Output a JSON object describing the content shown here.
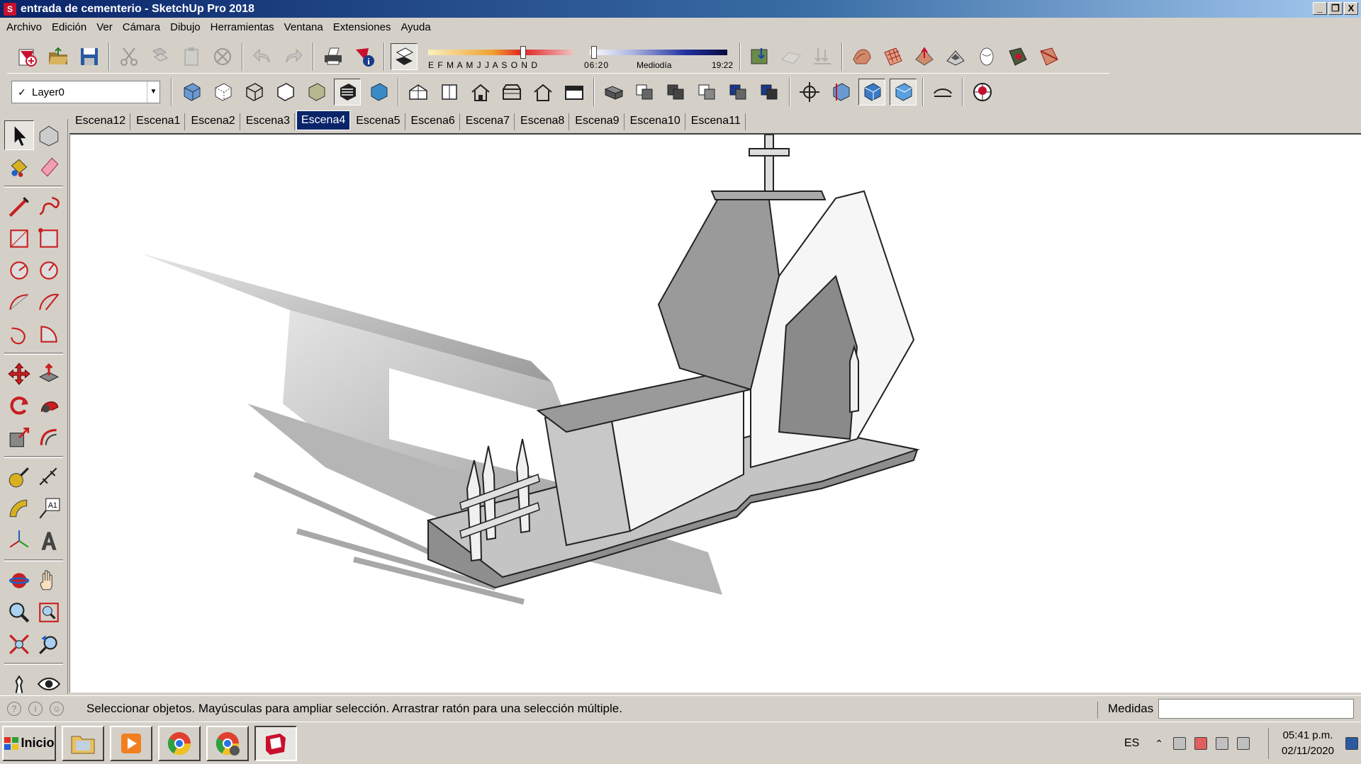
{
  "window": {
    "title": "entrada de cementerio - SketchUp Pro 2018",
    "buttons": [
      "_",
      "❐",
      "X"
    ]
  },
  "menu": [
    "Archivo",
    "Edición",
    "Ver",
    "Cámara",
    "Dibujo",
    "Herramientas",
    "Ventana",
    "Extensiones",
    "Ayuda"
  ],
  "toolbar": {
    "shadow_months": "E F M A M J J A S O N D",
    "shadow_time_start": "06:20",
    "shadow_time_mid": "Mediodía",
    "shadow_time_end": "19:22",
    "layer": "Layer0"
  },
  "scenes": {
    "tabs": [
      "Escena12",
      "Escena1",
      "Escena2",
      "Escena3",
      "Escena4",
      "Escena5",
      "Escena6",
      "Escena7",
      "Escena8",
      "Escena9",
      "Escena10",
      "Escena11"
    ],
    "active": "Escena4"
  },
  "status": {
    "text": "Seleccionar objetos. Mayúsculas para ampliar selección. Arrastrar ratón para una selección múltiple.",
    "measure_label": "Medidas",
    "measure_value": ""
  },
  "taskbar": {
    "start": "Inicio",
    "lang": "ES",
    "time": "05:41 p.m.",
    "date": "02/11/2020"
  },
  "colors": {
    "titlebar": "#0a246a",
    "sketchup_red": "#c8102e",
    "model_gray": "#9a9a9a",
    "shadow": "#bdbdbd"
  }
}
